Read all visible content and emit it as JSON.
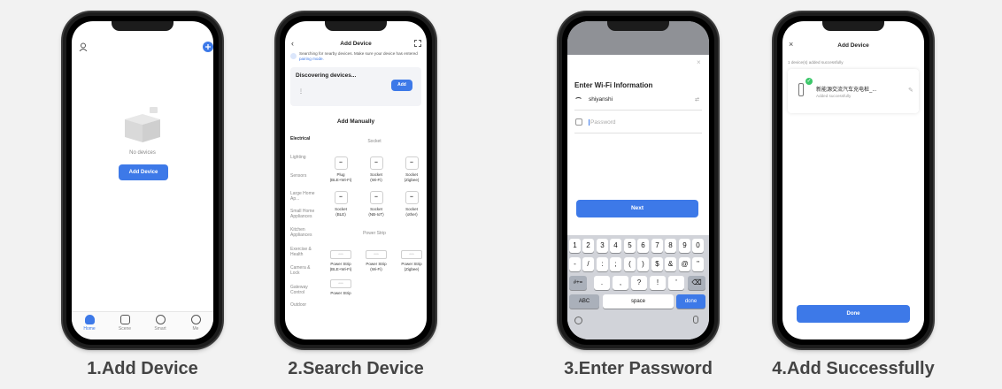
{
  "colors": {
    "accent": "#3d79e8",
    "caption": "#444444",
    "background": "#f2f2f2"
  },
  "steps": [
    {
      "caption": "1.Add Device"
    },
    {
      "caption": "2.Search Device"
    },
    {
      "caption": "3.Enter Password"
    },
    {
      "caption": "4.Add Successfully"
    }
  ],
  "phone1": {
    "empty_text": "No devices",
    "add_button": "Add Device",
    "nav": [
      "Home",
      "Scene",
      "Smart",
      "Me"
    ]
  },
  "phone2": {
    "title": "Add Device",
    "notice": "Searching for nearby devices. Make sure your device has entered",
    "notice_link": "pairing mode.",
    "discovering": "Discovering devices...",
    "discover_add": "Add",
    "manual_title": "Add Manually",
    "categories": [
      "Electrical",
      "Lighting",
      "Sensors",
      "Large Home Ap...",
      "Small Home Appliances",
      "Kitchen Appliances",
      "Exercise & Health",
      "Camera & Lock",
      "Gateway Control",
      "Outdoor"
    ],
    "section_socket": "Socket",
    "section_strip": "Power Strip",
    "sockets": [
      {
        "name": "Plug",
        "sub": "(BLE+Wi-Fi)"
      },
      {
        "name": "Socket",
        "sub": "(Wi-Fi)"
      },
      {
        "name": "Socket",
        "sub": "(Zigbee)"
      },
      {
        "name": "Socket",
        "sub": "(BLE)"
      },
      {
        "name": "Socket",
        "sub": "(NB-IoT)"
      },
      {
        "name": "Socket",
        "sub": "(other)"
      }
    ],
    "strips": [
      {
        "name": "Power Strip",
        "sub": "(BLE+Wi-Fi)"
      },
      {
        "name": "Power Strip",
        "sub": "(Wi-Fi)"
      },
      {
        "name": "Power Strip",
        "sub": "(Zigbee)"
      },
      {
        "name": "Power Strip",
        "sub": ""
      }
    ]
  },
  "phone3": {
    "title": "Enter Wi-Fi Information",
    "ssid": "shiyanshi",
    "password_placeholder": "Password",
    "next": "Next",
    "row1": [
      "1",
      "2",
      "3",
      "4",
      "5",
      "6",
      "7",
      "8",
      "9",
      "0"
    ],
    "row2": [
      "-",
      "/",
      ":",
      ";",
      "(",
      ")",
      "$",
      "&",
      "@",
      "\""
    ],
    "row3": [
      ".",
      ",",
      "?",
      "!",
      "'"
    ],
    "key_symbols": "#+=",
    "key_abc": "ABC",
    "key_space": "space",
    "key_done": "done"
  },
  "phone4": {
    "title": "Add Device",
    "summary": "1 device(s) added successfully",
    "device_name": "新能源交流汽车充电桩_...",
    "device_status": "Added successfully",
    "done": "Done"
  }
}
